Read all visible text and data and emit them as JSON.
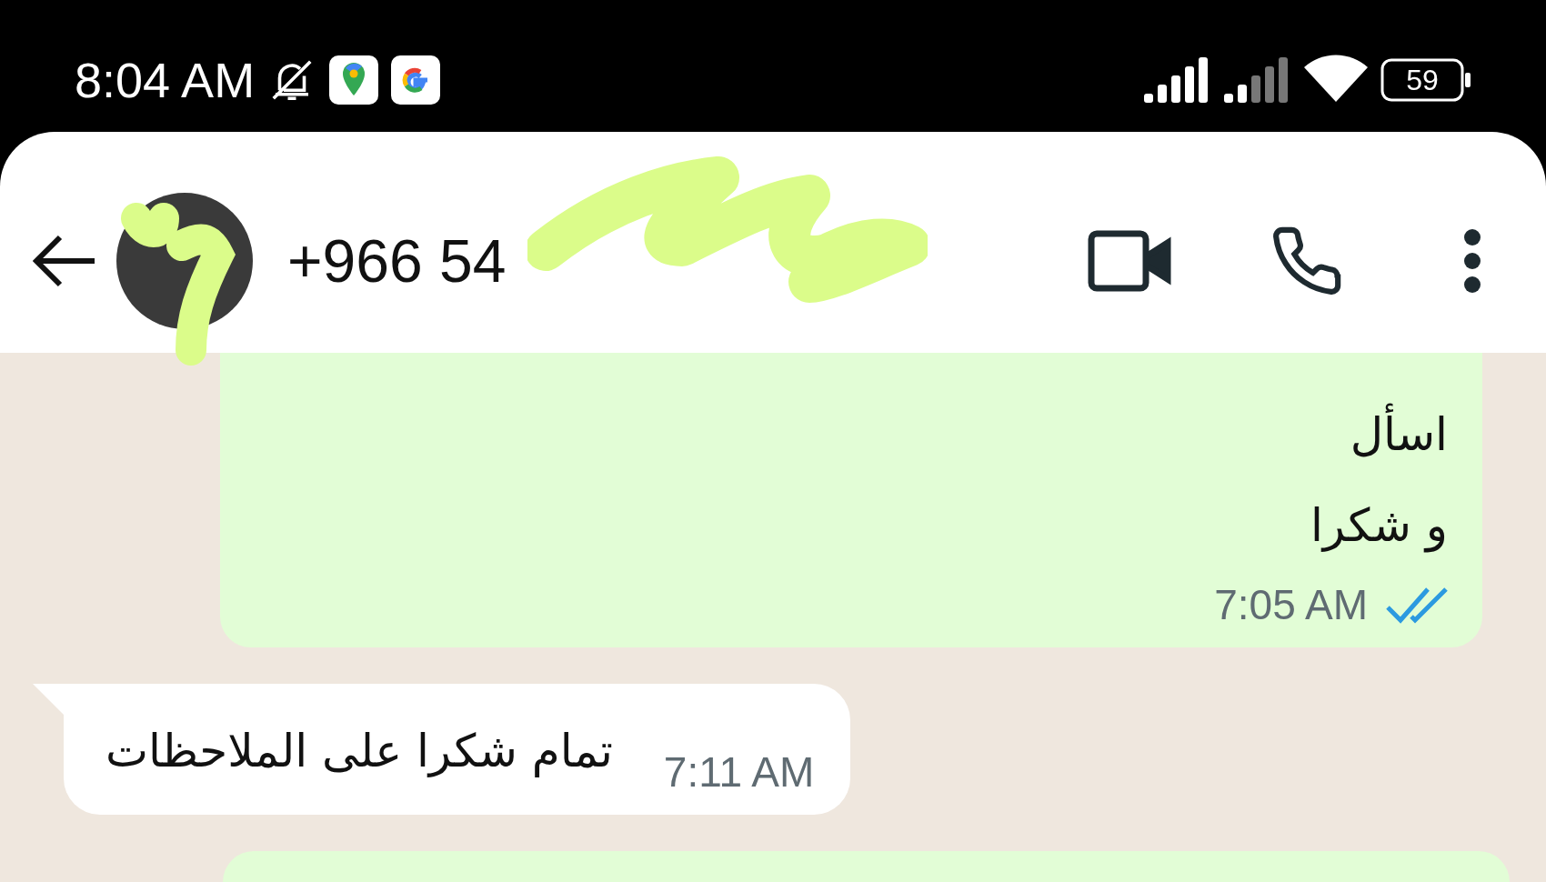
{
  "status_bar": {
    "time": "8:04 AM",
    "battery": "59"
  },
  "header": {
    "contact": "+966 54"
  },
  "messages": [
    {
      "kind": "outgoing",
      "lines": [
        "اسأل",
        "و شكرا"
      ],
      "time": "7:05 AM",
      "read": true
    },
    {
      "kind": "incoming",
      "text": "تمام شكرا على الملاحظات",
      "time": "7:11 AM"
    },
    {
      "kind": "cut"
    }
  ]
}
